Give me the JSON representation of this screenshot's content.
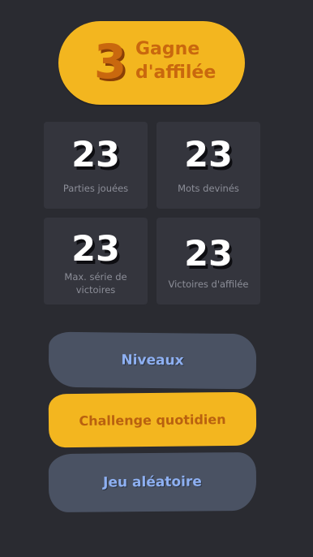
{
  "streak": {
    "number": "3",
    "label": "Gagne d'affilée"
  },
  "stats": [
    {
      "value": "23",
      "label": "Parties jouées"
    },
    {
      "value": "23",
      "label": "Mots devinés"
    },
    {
      "value": "23",
      "label": "Max. série de victoires"
    },
    {
      "value": "23",
      "label": "Victoires d'affilée"
    }
  ],
  "menu": {
    "levels_label": "Niveaux",
    "daily_label": "Challenge quotidien",
    "random_label": "Jeu aléatoire"
  },
  "colors": {
    "background": "#2a2b31",
    "accent_yellow": "#f3b61f",
    "accent_orange": "#c9680e",
    "card": "#34353d",
    "button_slate": "#4a5263",
    "button_text_blue": "#8eb0f2"
  }
}
